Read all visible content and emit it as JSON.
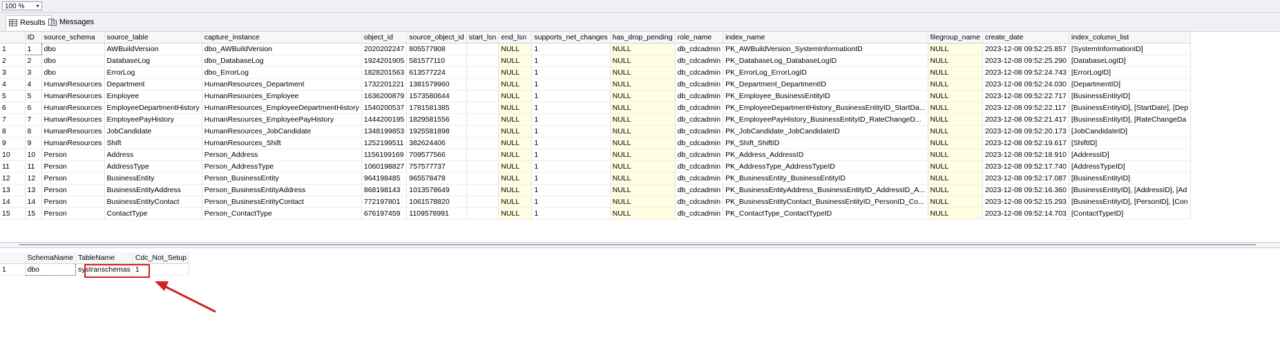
{
  "zoom": {
    "value": "100 %"
  },
  "tabs": [
    {
      "label": "Results",
      "icon": "grid-icon"
    },
    {
      "label": "Messages",
      "icon": "messages-icon"
    }
  ],
  "results": {
    "columns": [
      "ID",
      "source_schema",
      "source_table",
      "capture_instance",
      "object_id",
      "source_object_id",
      "start_lsn",
      "end_lsn",
      "supports_net_changes",
      "has_drop_pending",
      "role_name",
      "index_name",
      "filegroup_name",
      "create_date",
      "index_column_list"
    ],
    "rows": [
      [
        "1",
        "1",
        "dbo",
        "AWBuildVersion",
        "dbo_AWBuildVersion",
        "2020202247",
        "805577908",
        "",
        "NULL",
        "1",
        "NULL",
        "db_cdcadmin",
        "PK_AWBuildVersion_SystemInformationID",
        "NULL",
        "2023-12-08 09:52:25.857",
        "[SystemInformationID]"
      ],
      [
        "2",
        "2",
        "dbo",
        "DatabaseLog",
        "dbo_DatabaseLog",
        "1924201905",
        "581577110",
        "",
        "NULL",
        "1",
        "NULL",
        "db_cdcadmin",
        "PK_DatabaseLog_DatabaseLogID",
        "NULL",
        "2023-12-08 09:52:25.290",
        "[DatabaseLogID]"
      ],
      [
        "3",
        "3",
        "dbo",
        "ErrorLog",
        "dbo_ErrorLog",
        "1828201563",
        "613577224",
        "",
        "NULL",
        "1",
        "NULL",
        "db_cdcadmin",
        "PK_ErrorLog_ErrorLogID",
        "NULL",
        "2023-12-08 09:52:24.743",
        "[ErrorLogID]"
      ],
      [
        "4",
        "4",
        "HumanResources",
        "Department",
        "HumanResources_Department",
        "1732201221",
        "1381579960",
        "",
        "NULL",
        "1",
        "NULL",
        "db_cdcadmin",
        "PK_Department_DepartmentID",
        "NULL",
        "2023-12-08 09:52:24.030",
        "[DepartmentID]"
      ],
      [
        "5",
        "5",
        "HumanResources",
        "Employee",
        "HumanResources_Employee",
        "1636200879",
        "1573580644",
        "",
        "NULL",
        "1",
        "NULL",
        "db_cdcadmin",
        "PK_Employee_BusinessEntityID",
        "NULL",
        "2023-12-08 09:52:22.717",
        "[BusinessEntityID]"
      ],
      [
        "6",
        "6",
        "HumanResources",
        "EmployeeDepartmentHistory",
        "HumanResources_EmployeeDepartmentHistory",
        "1540200537",
        "1781581385",
        "",
        "NULL",
        "1",
        "NULL",
        "db_cdcadmin",
        "PK_EmployeeDepartmentHistory_BusinessEntityID_StartDa...",
        "NULL",
        "2023-12-08 09:52:22.117",
        "[BusinessEntityID], [StartDate], [Dep"
      ],
      [
        "7",
        "7",
        "HumanResources",
        "EmployeePayHistory",
        "HumanResources_EmployeePayHistory",
        "1444200195",
        "1829581556",
        "",
        "NULL",
        "1",
        "NULL",
        "db_cdcadmin",
        "PK_EmployeePayHistory_BusinessEntityID_RateChangeD...",
        "NULL",
        "2023-12-08 09:52:21.417",
        "[BusinessEntityID], [RateChangeDa"
      ],
      [
        "8",
        "8",
        "HumanResources",
        "JobCandidate",
        "HumanResources_JobCandidate",
        "1348199853",
        "1925581898",
        "",
        "NULL",
        "1",
        "NULL",
        "db_cdcadmin",
        "PK_JobCandidate_JobCandidateID",
        "NULL",
        "2023-12-08 09:52:20.173",
        "[JobCandidateID]"
      ],
      [
        "9",
        "9",
        "HumanResources",
        "Shift",
        "HumanResources_Shift",
        "1252199511",
        "382624406",
        "",
        "NULL",
        "1",
        "NULL",
        "db_cdcadmin",
        "PK_Shift_ShiftID",
        "NULL",
        "2023-12-08 09:52:19.617",
        "[ShiftID]"
      ],
      [
        "10",
        "10",
        "Person",
        "Address",
        "Person_Address",
        "1156199169",
        "709577566",
        "",
        "NULL",
        "1",
        "NULL",
        "db_cdcadmin",
        "PK_Address_AddressID",
        "NULL",
        "2023-12-08 09:52:18.910",
        "[AddressID]"
      ],
      [
        "11",
        "11",
        "Person",
        "AddressType",
        "Person_AddressType",
        "1060198827",
        "757577737",
        "",
        "NULL",
        "1",
        "NULL",
        "db_cdcadmin",
        "PK_AddressType_AddressTypeID",
        "NULL",
        "2023-12-08 09:52:17.740",
        "[AddressTypeID]"
      ],
      [
        "12",
        "12",
        "Person",
        "BusinessEntity",
        "Person_BusinessEntity",
        "964198485",
        "965578478",
        "",
        "NULL",
        "1",
        "NULL",
        "db_cdcadmin",
        "PK_BusinessEntity_BusinessEntityID",
        "NULL",
        "2023-12-08 09:52:17.087",
        "[BusinessEntityID]"
      ],
      [
        "13",
        "13",
        "Person",
        "BusinessEntityAddress",
        "Person_BusinessEntityAddress",
        "868198143",
        "1013578649",
        "",
        "NULL",
        "1",
        "NULL",
        "db_cdcadmin",
        "PK_BusinessEntityAddress_BusinessEntityID_AddressID_A...",
        "NULL",
        "2023-12-08 09:52:16.360",
        "[BusinessEntityID], [AddressID], [Ad"
      ],
      [
        "14",
        "14",
        "Person",
        "BusinessEntityContact",
        "Person_BusinessEntityContact",
        "772197801",
        "1061578820",
        "",
        "NULL",
        "1",
        "NULL",
        "db_cdcadmin",
        "PK_BusinessEntityContact_BusinessEntityID_PersonID_Co...",
        "NULL",
        "2023-12-08 09:52:15.293",
        "[BusinessEntityID], [PersonID], [Con"
      ],
      [
        "15",
        "15",
        "Person",
        "ContactType",
        "Person_ContactType",
        "676197459",
        "1109578991",
        "",
        "NULL",
        "1",
        "NULL",
        "db_cdcadmin",
        "PK_ContactType_ContactTypeID",
        "NULL",
        "2023-12-08 09:52:14.703",
        "[ContactTypeID]"
      ]
    ]
  },
  "results2": {
    "columns": [
      "SchemaName",
      "TableName",
      "Cdc_Not_Setup"
    ],
    "rows": [
      [
        "1",
        "dbo",
        "systranschemas",
        "1"
      ]
    ]
  },
  "colors": {
    "highlight": "#d21f1f",
    "null_bg": "#fffde2"
  }
}
